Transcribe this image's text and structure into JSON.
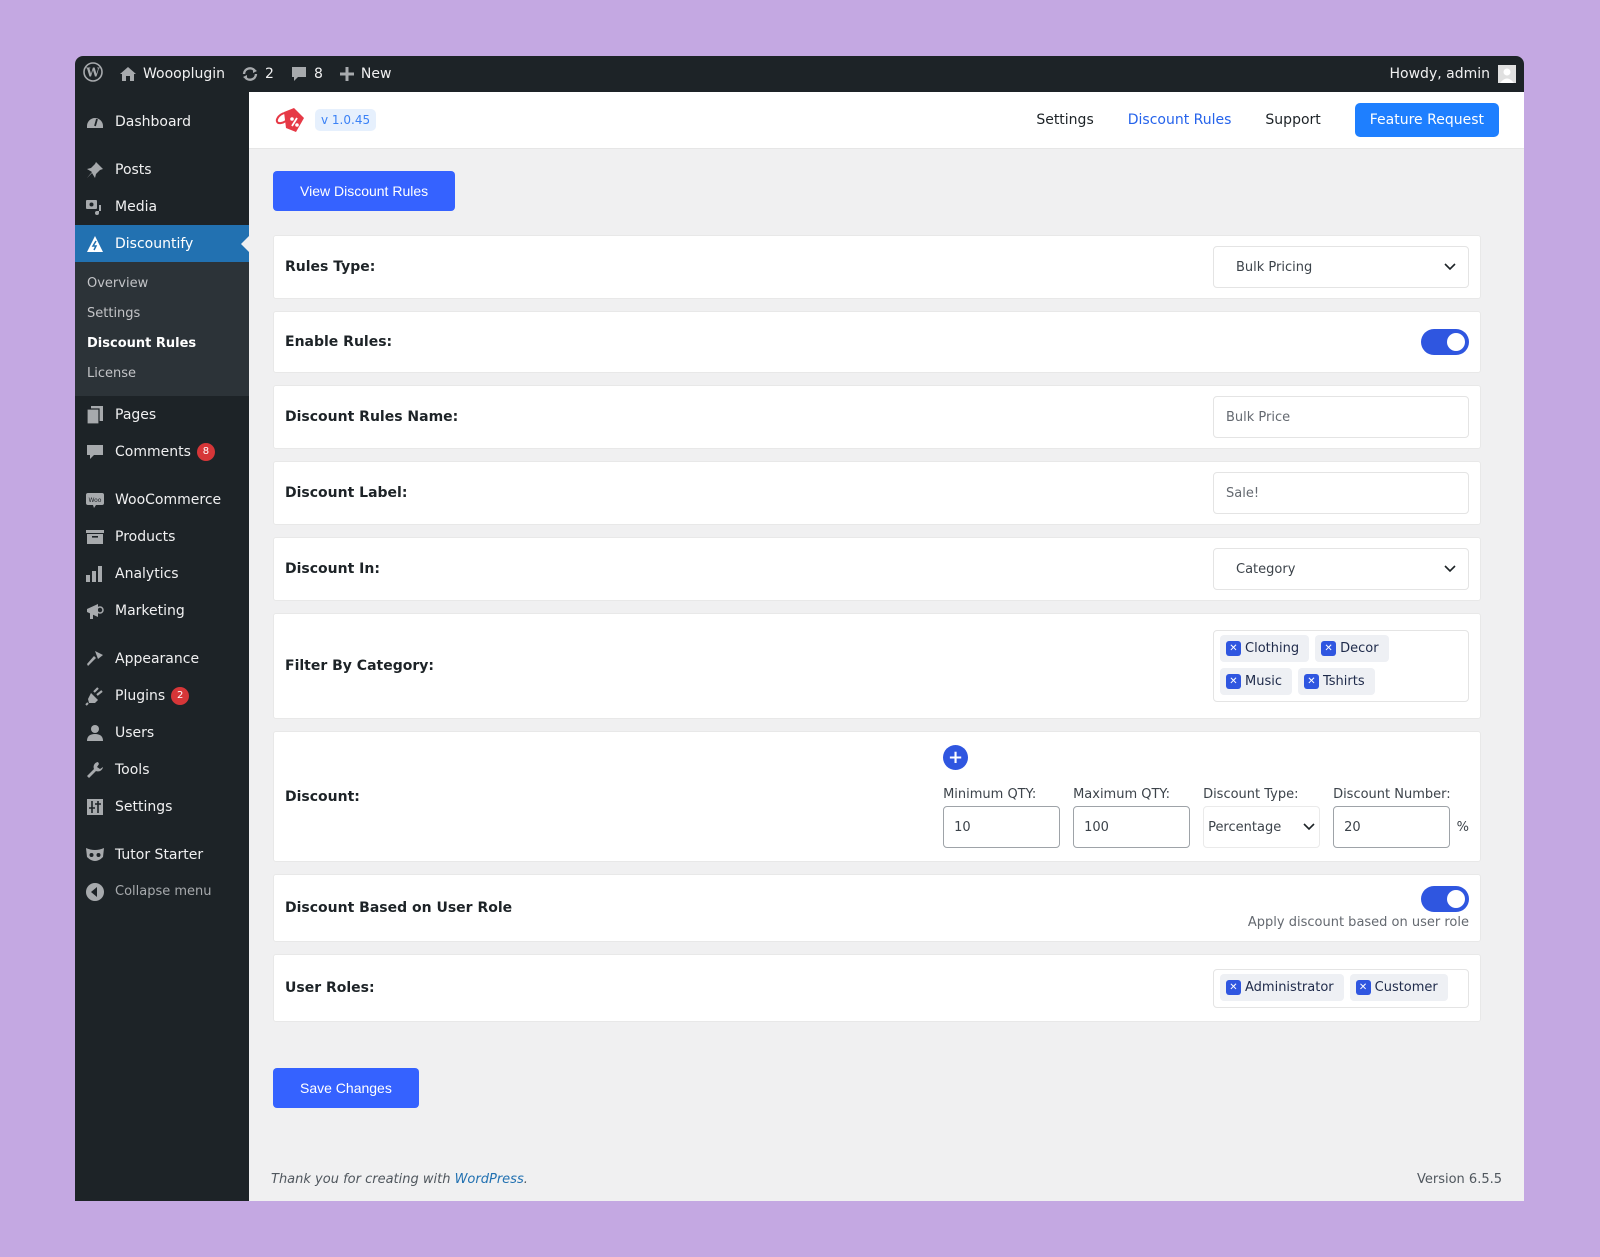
{
  "adminbar": {
    "site_name": "Woooplugin",
    "updates_count": "2",
    "comments_count": "8",
    "new_label": "New",
    "greeting": "Howdy, admin"
  },
  "sidebar": {
    "items": [
      {
        "label": "Dashboard",
        "icon": "dashboard-icon"
      },
      {
        "label": "Posts",
        "icon": "pin-icon"
      },
      {
        "label": "Media",
        "icon": "media-icon"
      },
      {
        "label": "Discountify",
        "icon": "discountify-icon",
        "active": true
      },
      {
        "label": "Pages",
        "icon": "pages-icon"
      },
      {
        "label": "Comments",
        "icon": "comment-icon",
        "badge": "8"
      },
      {
        "label": "WooCommerce",
        "icon": "woo-icon"
      },
      {
        "label": "Products",
        "icon": "archive-icon"
      },
      {
        "label": "Analytics",
        "icon": "bar-chart-icon"
      },
      {
        "label": "Marketing",
        "icon": "megaphone-icon"
      },
      {
        "label": "Appearance",
        "icon": "brush-icon"
      },
      {
        "label": "Plugins",
        "icon": "plug-icon",
        "badge": "2"
      },
      {
        "label": "Users",
        "icon": "user-icon"
      },
      {
        "label": "Tools",
        "icon": "wrench-icon"
      },
      {
        "label": "Settings",
        "icon": "sliders-icon"
      },
      {
        "label": "Tutor Starter",
        "icon": "owl-icon"
      },
      {
        "label": "Collapse menu",
        "icon": "collapse-icon"
      }
    ],
    "submenu": [
      {
        "label": "Overview"
      },
      {
        "label": "Settings"
      },
      {
        "label": "Discount Rules",
        "current": true
      },
      {
        "label": "License"
      }
    ]
  },
  "plugin_header": {
    "version": "v 1.0.45",
    "nav": [
      "Settings",
      "Discount Rules",
      "Support"
    ],
    "feature_request": "Feature Request",
    "active_nav": "Discount Rules"
  },
  "page": {
    "view_rules_button": "View Discount Rules",
    "save_button": "Save Changes",
    "fields": {
      "rules_type": {
        "label": "Rules Type:",
        "value": "Bulk Pricing"
      },
      "enable_rules": {
        "label": "Enable Rules:",
        "enabled": true
      },
      "rules_name": {
        "label": "Discount Rules Name:",
        "value": "Bulk Price"
      },
      "discount_label": {
        "label": "Discount Label:",
        "value": "Sale!"
      },
      "discount_in": {
        "label": "Discount In:",
        "value": "Category"
      },
      "filter_category": {
        "label": "Filter By Category:",
        "tags": [
          "Clothing",
          "Decor",
          "Music",
          "Tshirts"
        ]
      },
      "discount": {
        "label": "Discount:",
        "min_qty_label": "Minimum QTY:",
        "min_qty": "10",
        "max_qty_label": "Maximum QTY:",
        "max_qty": "100",
        "type_label": "Discount Type:",
        "type": "Percentage",
        "number_label": "Discount Number:",
        "number": "20",
        "unit": "%"
      },
      "user_role_toggle": {
        "label": "Discount Based on User Role",
        "enabled": true,
        "helper": "Apply discount based on user role"
      },
      "user_roles": {
        "label": "User Roles:",
        "tags": [
          "Administrator",
          "Customer"
        ]
      }
    }
  },
  "footer": {
    "thanks_prefix": "Thank you for creating with ",
    "thanks_link": "WordPress",
    "thanks_suffix": ".",
    "version": "Version 6.5.5"
  }
}
